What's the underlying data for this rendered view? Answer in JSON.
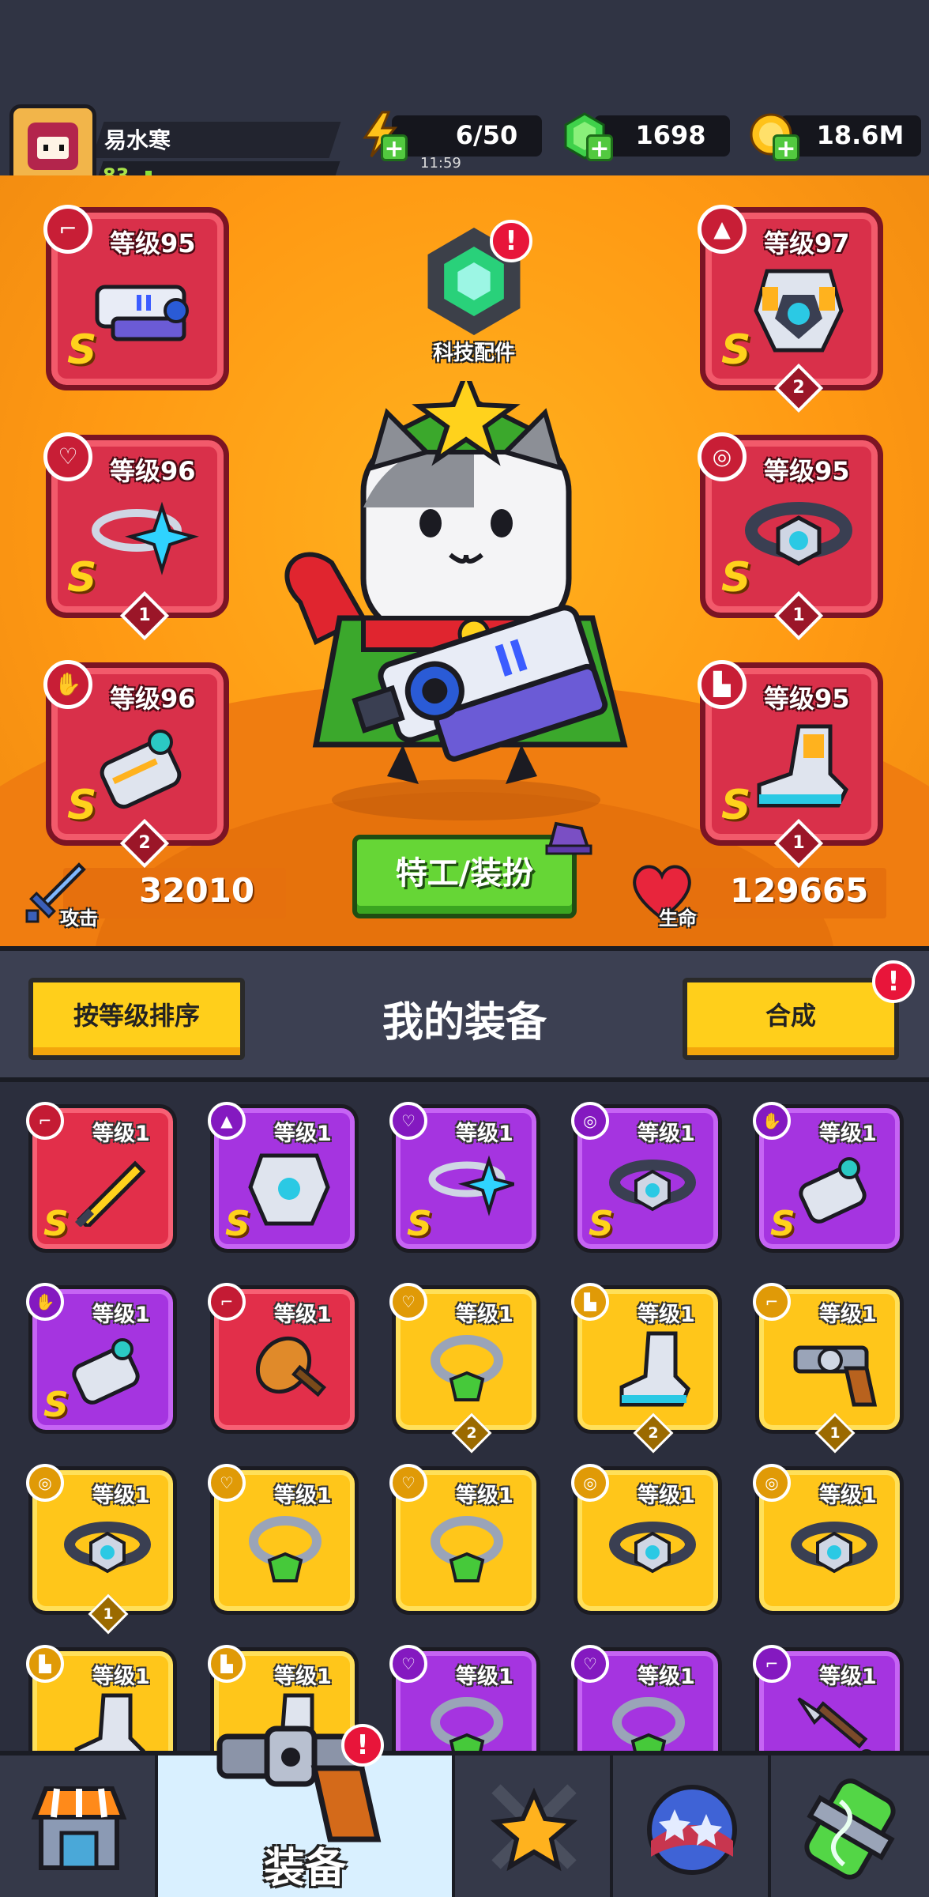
{
  "player": {
    "name": "易水寒",
    "level": "83"
  },
  "resources": {
    "energy": {
      "value": "6/50",
      "timer": "11:59",
      "icon": "lightning-icon"
    },
    "gems": {
      "value": "1698",
      "icon": "green-gem-icon"
    },
    "coins": {
      "value": "18.6M",
      "icon": "gold-coin-icon"
    }
  },
  "tech_parts": {
    "label": "科技配件",
    "alert": "!"
  },
  "equipped": [
    {
      "slot": "weapon",
      "level_label": "等级95",
      "rank": "S",
      "stars": "",
      "icon": "gun-badge-icon"
    },
    {
      "slot": "armor",
      "level_label": "等级97",
      "rank": "S",
      "stars": "2",
      "icon": "shirt-badge-icon"
    },
    {
      "slot": "necklace",
      "level_label": "等级96",
      "rank": "S",
      "stars": "1",
      "icon": "necklace-badge-icon"
    },
    {
      "slot": "belt",
      "level_label": "等级95",
      "rank": "S",
      "stars": "1",
      "icon": "belt-badge-icon"
    },
    {
      "slot": "glove",
      "level_label": "等级96",
      "rank": "S",
      "stars": "2",
      "icon": "glove-badge-icon"
    },
    {
      "slot": "boots",
      "level_label": "等级95",
      "rank": "S",
      "stars": "1",
      "icon": "boot-badge-icon"
    }
  ],
  "stats": {
    "attack": {
      "label": "攻击",
      "value": "32010"
    },
    "hp": {
      "label": "生命",
      "value": "129665"
    }
  },
  "agent_button": "特工/装扮",
  "equipment_header": {
    "sort_button": "按等级排序",
    "title": "我的装备",
    "merge_button": "合成",
    "merge_alert": "!"
  },
  "inventory": [
    {
      "rarity": "red",
      "level_label": "等级1",
      "rank": "S",
      "stars": "",
      "type": "sword"
    },
    {
      "rarity": "purple",
      "level_label": "等级1",
      "rank": "S",
      "stars": "",
      "type": "armor"
    },
    {
      "rarity": "purple",
      "level_label": "等级1",
      "rank": "S",
      "stars": "",
      "type": "necklace"
    },
    {
      "rarity": "purple",
      "level_label": "等级1",
      "rank": "S",
      "stars": "",
      "type": "belt"
    },
    {
      "rarity": "purple",
      "level_label": "等级1",
      "rank": "S",
      "stars": "",
      "type": "glove"
    },
    {
      "rarity": "purple",
      "level_label": "等级1",
      "rank": "S",
      "stars": "",
      "type": "glove"
    },
    {
      "rarity": "red",
      "level_label": "等级1",
      "rank": "",
      "stars": "",
      "type": "club"
    },
    {
      "rarity": "gold",
      "level_label": "等级1",
      "rank": "",
      "stars": "2",
      "type": "ring"
    },
    {
      "rarity": "gold",
      "level_label": "等级1",
      "rank": "",
      "stars": "2",
      "type": "boot"
    },
    {
      "rarity": "gold",
      "level_label": "等级1",
      "rank": "",
      "stars": "1",
      "type": "revolver"
    },
    {
      "rarity": "gold",
      "level_label": "等级1",
      "rank": "",
      "stars": "1",
      "type": "belt"
    },
    {
      "rarity": "gold",
      "level_label": "等级1",
      "rank": "",
      "stars": "",
      "type": "ring"
    },
    {
      "rarity": "gold",
      "level_label": "等级1",
      "rank": "",
      "stars": "",
      "type": "ring"
    },
    {
      "rarity": "gold",
      "level_label": "等级1",
      "rank": "",
      "stars": "",
      "type": "belt"
    },
    {
      "rarity": "gold",
      "level_label": "等级1",
      "rank": "",
      "stars": "",
      "type": "belt"
    },
    {
      "rarity": "gold",
      "level_label": "等级1",
      "rank": "",
      "stars": "",
      "type": "boot"
    },
    {
      "rarity": "gold",
      "level_label": "等级1",
      "rank": "",
      "stars": "",
      "type": "boot"
    },
    {
      "rarity": "purple",
      "level_label": "等级1",
      "rank": "",
      "stars": "",
      "type": "ring"
    },
    {
      "rarity": "purple",
      "level_label": "等级1",
      "rank": "",
      "stars": "",
      "type": "ring"
    },
    {
      "rarity": "purple",
      "level_label": "等级1",
      "rank": "",
      "stars": "",
      "type": "kunai"
    }
  ],
  "nav": [
    {
      "label": "",
      "icon": "shop-icon"
    },
    {
      "label": "装备",
      "icon": "revolver-icon",
      "alert": "!"
    },
    {
      "label": "",
      "icon": "crossed-swords-star-icon"
    },
    {
      "label": "",
      "icon": "star-planet-icon"
    },
    {
      "label": "",
      "icon": "dna-capsule-icon"
    }
  ],
  "colors": {
    "hero_bg": "#ff9913",
    "red_card": "#e22f4a",
    "purple_card": "#a534e0",
    "gold_card": "#ffc61a",
    "green_button": "#66d636",
    "yellow_button": "#ffcf1b"
  }
}
